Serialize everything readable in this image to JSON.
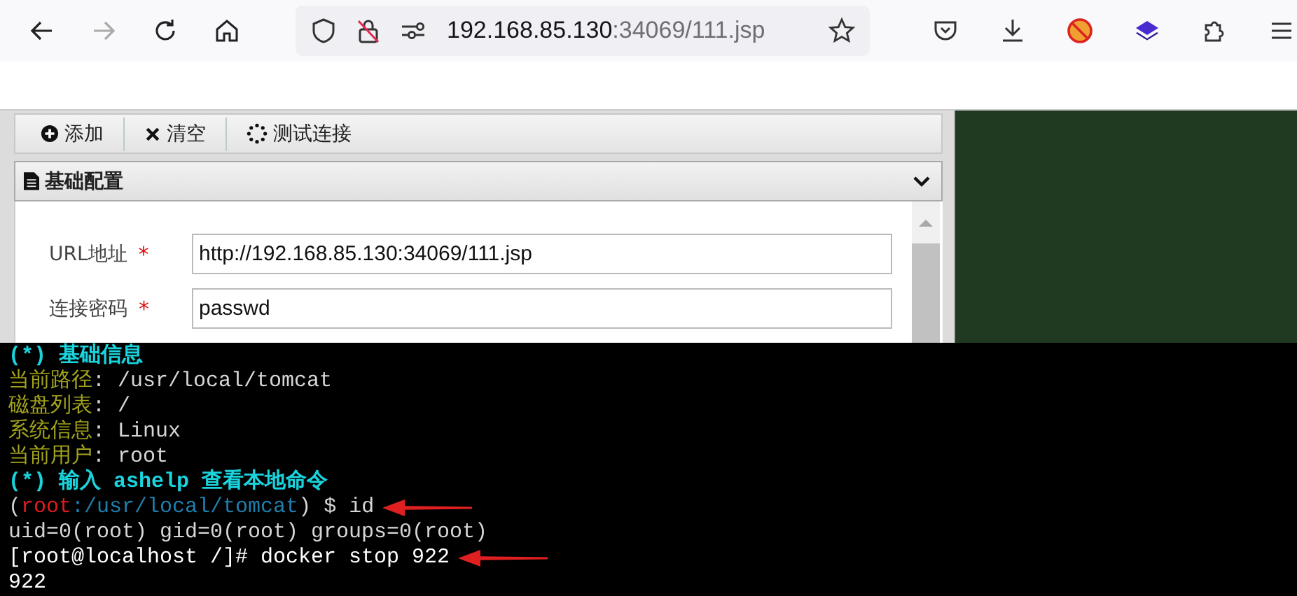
{
  "browser": {
    "url_host": "192.168.85.130",
    "url_rest": ":34069/111.jsp",
    "forward_disabled": true
  },
  "toolbar": {
    "buttons": [
      {
        "label": "添加",
        "kind": "add"
      },
      {
        "label": "清空",
        "kind": "clear"
      },
      {
        "label": "测试连接",
        "kind": "test"
      }
    ]
  },
  "panel": {
    "title": "基础配置",
    "expanded": true,
    "fields": [
      {
        "label": "URL地址",
        "required_mark": "*",
        "value": "http://192.168.85.130:34069/111.jsp"
      },
      {
        "label": "连接密码",
        "required_mark": "*",
        "value": "passwd"
      }
    ]
  },
  "terminal": {
    "lines": [
      {
        "arrow": false,
        "segments": [
          {
            "text": "(*) 基础信息",
            "kind": "heading"
          }
        ]
      },
      {
        "arrow": false,
        "segments": [
          {
            "text": "当前路径",
            "kind": "label"
          },
          {
            "text": ": /usr/local/tomcat",
            "kind": "value"
          }
        ]
      },
      {
        "arrow": false,
        "segments": [
          {
            "text": "磁盘列表",
            "kind": "label"
          },
          {
            "text": ": /",
            "kind": "value"
          }
        ]
      },
      {
        "arrow": false,
        "segments": [
          {
            "text": "系统信息",
            "kind": "label"
          },
          {
            "text": ": Linux",
            "kind": "value"
          }
        ]
      },
      {
        "arrow": false,
        "segments": [
          {
            "text": "当前用户",
            "kind": "label"
          },
          {
            "text": ": root",
            "kind": "value"
          }
        ]
      },
      {
        "arrow": false,
        "segments": [
          {
            "text": "(*) 输入 ashelp 查看本地命令",
            "kind": "heading"
          }
        ]
      },
      {
        "arrow": true,
        "segments": [
          {
            "text": "(",
            "kind": "value"
          },
          {
            "text": "root",
            "kind": "user"
          },
          {
            "text": ":/usr/local/tomcat",
            "kind": "path"
          },
          {
            "text": ") $ id",
            "kind": "value"
          }
        ]
      },
      {
        "arrow": false,
        "segments": [
          {
            "text": "uid=0(root) gid=0(root) groups=0(root)",
            "kind": "value"
          }
        ]
      },
      {
        "arrow": true,
        "segments": [
          {
            "text": "[root@localhost /]# docker stop 922",
            "kind": "shell"
          }
        ]
      },
      {
        "arrow": false,
        "segments": [
          {
            "text": "922",
            "kind": "shell"
          }
        ]
      }
    ]
  }
}
